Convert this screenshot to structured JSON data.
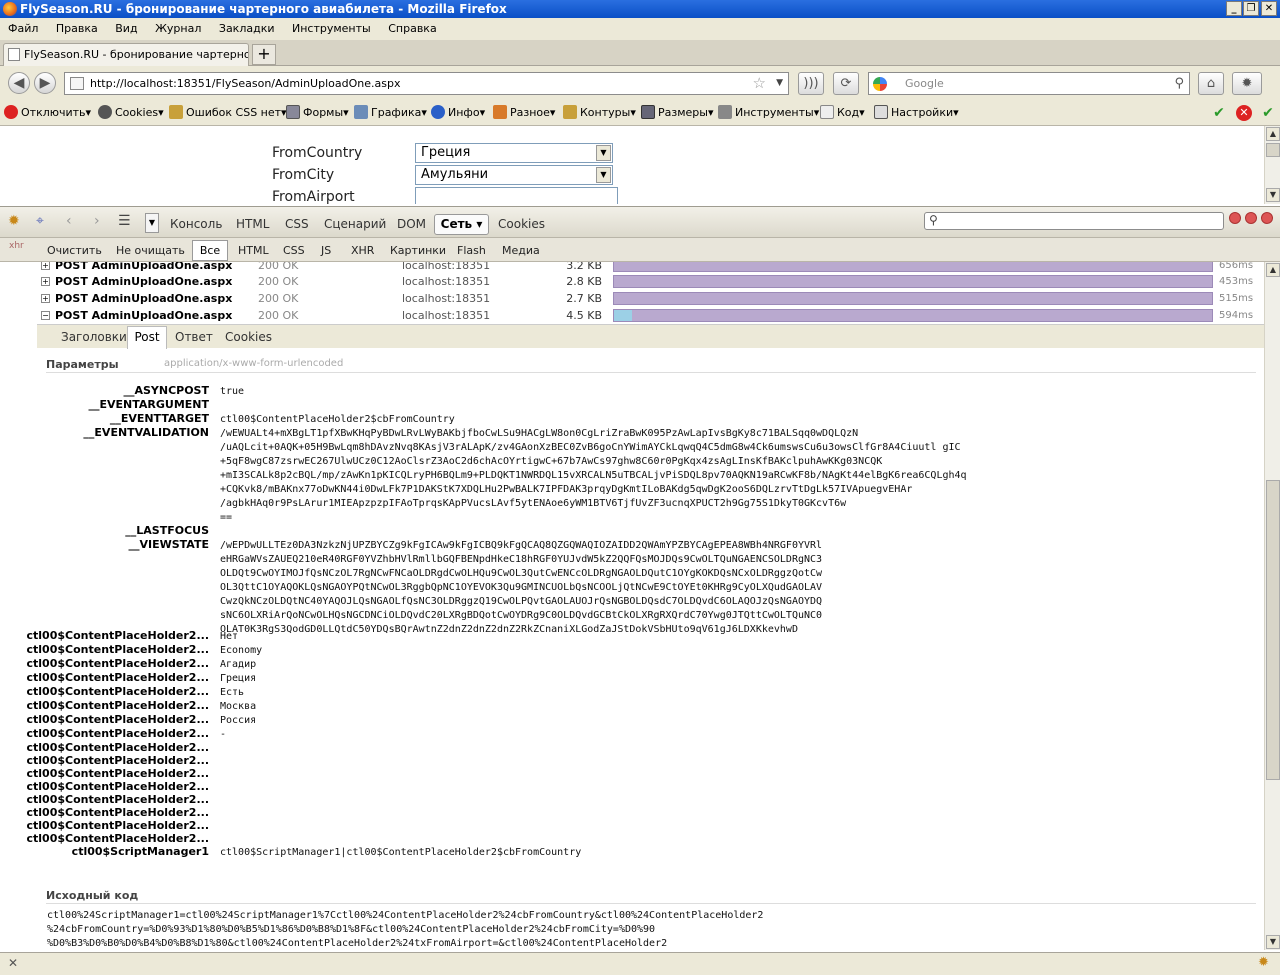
{
  "window": {
    "title": "FlySeason.RU - бронирование чартерного авиабилета - Mozilla Firefox"
  },
  "menu": [
    "Файл",
    "Правка",
    "Вид",
    "Журнал",
    "Закладки",
    "Инструменты",
    "Справка"
  ],
  "tab": {
    "title": "FlySeason.RU - бронирование чартерного ...",
    "new_tab": "+"
  },
  "nav": {
    "url": "http://localhost:18351/FlySeason/AdminUploadOne.aspx",
    "search_placeholder": "Google"
  },
  "webdev_toolbar": [
    "Отключить",
    "Cookies",
    "Ошибок CSS нет",
    "Формы",
    "Графика",
    "Инфо",
    "Разное",
    "Контуры",
    "Размеры",
    "Инструменты",
    "Код",
    "Настройки"
  ],
  "page": {
    "fields": [
      {
        "label": "FromCountry",
        "value": "Греция"
      },
      {
        "label": "FromCity",
        "value": "Амульяни"
      },
      {
        "label": "FromAirport",
        "value": ""
      }
    ]
  },
  "firebug": {
    "tabs": [
      "Консоль",
      "HTML",
      "CSS",
      "Сценарий",
      "DOM",
      "Сеть",
      "Cookies"
    ],
    "active_tab": "Сеть",
    "filters": [
      "Очистить",
      "Не очищать",
      "Все",
      "HTML",
      "CSS",
      "JS",
      "XHR",
      "Картинки",
      "Flash",
      "Медиа"
    ],
    "requests": [
      {
        "method": "POST AdminUploadOne.aspx",
        "status": "200 OK",
        "domain": "localhost:18351",
        "size": "3.2 KB",
        "time": "656ms"
      },
      {
        "method": "POST AdminUploadOne.aspx",
        "status": "200 OK",
        "domain": "localhost:18351",
        "size": "2.8 KB",
        "time": "453ms"
      },
      {
        "method": "POST AdminUploadOne.aspx",
        "status": "200 OK",
        "domain": "localhost:18351",
        "size": "2.7 KB",
        "time": "515ms"
      },
      {
        "method": "POST AdminUploadOne.aspx",
        "status": "200 OK",
        "domain": "localhost:18351",
        "size": "4.5 KB",
        "time": "594ms"
      }
    ],
    "subtabs": [
      "Заголовки",
      "Post",
      "Ответ",
      "Cookies"
    ],
    "params_title": "Параметры",
    "params_type": "application/x-www-form-urlencoded",
    "params": [
      {
        "k": "__ASYNCPOST",
        "v": "true"
      },
      {
        "k": "__EVENTARGUMENT",
        "v": ""
      },
      {
        "k": "__EVENTTARGET",
        "v": "ctl00$ContentPlaceHolder2$cbFromCountry"
      },
      {
        "k": "__EVENTVALIDATION",
        "v": "/wEWUALt4+mXBgLT1pfXBwKHqPyBDwLRvLWyBAKbjfboCwLSu9HACgLW8on0CgLriZraBwK095PzAwLapIvsBgKy8c71BALSqq0wDQLQzN\n/uAQLcit+0AQK+05H9BwLqm8hDAvzNvq8KAsjV3rALApK/zv4GAonXzBEC0ZvB6goCnYWimAYCkLqwqQ4C5dmG8w4Ck6umswsCu6u3owsClfGr8A4Ciuutl gIC\n+5qF8wgC87zsrwEC267UlwUCz0C12AoClsrZ3AoC2d6chAcOYrtigwC+67b7AwCs97ghw8C60r0PgKqx4zsAgLInsKfBAKclpuhAwKKg03NCQK\n+mI3SCALk8p2cBQL/mp/zAwKn1pKICQLryPH6BQLm9+PLDQKT1NWRDQL15vXRCALN5uTBCALjvPiSDQL8pv70AQKN19aRCwKF8b/NAgKt44elBgK6rea6CQLgh4q\n+CQKvk8/mBAKnx77oDwKN44i0DwLFk7P1DAKStK7XDQLHu2PwBALK7IPFDAK3prqyDgKmtILoBAKdg5qwDgK2ooS6DQLzrvTtDgLk57IVApuegvEHAr\n/agbkHAq0r9PsLArur1MIEApzpzpIFAoTprqsKApPVucsLAvf5ytENAoe6yWM1BTV6TjfUvZF3ucnqXPUCT2h9Gg75S1DkyT0GKcvT6w\n=="
      },
      {
        "k": "__LASTFOCUS",
        "v": ""
      },
      {
        "k": "__VIEWSTATE",
        "v": "/wEPDwULLTEz0DA3NzkzNjUPZBYCZg9kFgICAw9kFgICBQ9kFgQCAQ8QZGQWAQIOZAIDD2QWAmYPZBYCAgEPEA8WBh4NRGF0YVRl\neHRGaWVsZAUEQ210eR40RGF0YVZhbHVlRmllbGQFBENpdHkeC18hRGF0YUJvdW5kZ2QQFQsMOJDQs9CwOLTQuNGAENCSOLDRgNC3\nOLDQt9CwOYIMOJfQsNCzOL7RgNCwFNCaOLDRgdCwOLHQu9CwOL3QutCwENCcOLDRgNGAOLDQutC1OYgKOKDQsNCxOLDRggzQotCw\nOL3QttC1OYAQOKLQsNGAOYPQtNCwOL3RggbQpNC1OYEVOK3Qu9GMINCUOLbQsNCOOLjQtNCwE9CtOYEt0KHRg9CyOLXQudGAOLAV\nCwzQkNCzOLDQtNC40YAQOJLQsNGAOLfQsNC3OLDRggzQ19CwOLPQvtGAOLAUOJrQsNGBOLDQsdC7OLDQvdC6OLAQOJzQsNGAOYDQ\nsNC6OLXRiArQoNCwOLHQsNGCDNCiOLDQvdC20LXRgBDQotCwOYDRg9C0OLDQvdGCBtCkOLXRgRXQrdC70Ywg0JTQttCwOLTQuNC0\nOLAT0K3RgS3QodGD0LLQtdC50YDQsBQrAwtnZ2dnZ2dnZ2dnZ2RkZCnaniXLGodZaJStDokVSbHUto9qV61gJ6LDXKkevhwD"
      },
      {
        "k": "ctl00$ContentPlaceHolder2...",
        "v": "Нет"
      },
      {
        "k": "ctl00$ContentPlaceHolder2...",
        "v": "Economy"
      },
      {
        "k": "ctl00$ContentPlaceHolder2...",
        "v": "Агадир"
      },
      {
        "k": "ctl00$ContentPlaceHolder2...",
        "v": "Греция"
      },
      {
        "k": "ctl00$ContentPlaceHolder2...",
        "v": "Есть"
      },
      {
        "k": "ctl00$ContentPlaceHolder2...",
        "v": "Москва"
      },
      {
        "k": "ctl00$ContentPlaceHolder2...",
        "v": "Россия"
      },
      {
        "k": "ctl00$ContentPlaceHolder2...",
        "v": "-"
      },
      {
        "k": "ctl00$ContentPlaceHolder2...",
        "v": ""
      },
      {
        "k": "ctl00$ContentPlaceHolder2...",
        "v": ""
      },
      {
        "k": "ctl00$ContentPlaceHolder2...",
        "v": ""
      },
      {
        "k": "ctl00$ContentPlaceHolder2...",
        "v": ""
      },
      {
        "k": "ctl00$ContentPlaceHolder2...",
        "v": ""
      },
      {
        "k": "ctl00$ContentPlaceHolder2...",
        "v": ""
      },
      {
        "k": "ctl00$ContentPlaceHolder2...",
        "v": ""
      },
      {
        "k": "ctl00$ContentPlaceHolder2...",
        "v": ""
      },
      {
        "k": "ctl00$ScriptManager1",
        "v": "ctl00$ScriptManager1|ctl00$ContentPlaceHolder2$cbFromCountry"
      }
    ],
    "source_title": "Исходный код",
    "source": "ctl00%24ScriptManager1=ctl00%24ScriptManager1%7Cctl00%24ContentPlaceHolder2%24cbFromCountry&ctl00%24ContentPlaceHolder2\n%24cbFromCountry=%D0%93%D1%80%D0%B5%D1%86%D0%B8%D1%8F&ctl00%24ContentPlaceHolder2%24cbFromCity=%D0%90\n%D0%B3%D0%B0%D0%B4%D0%B8%D1%80&ctl00%24ContentPlaceHolder2%24txFromAirport=&ctl00%24ContentPlaceHolder2"
  }
}
